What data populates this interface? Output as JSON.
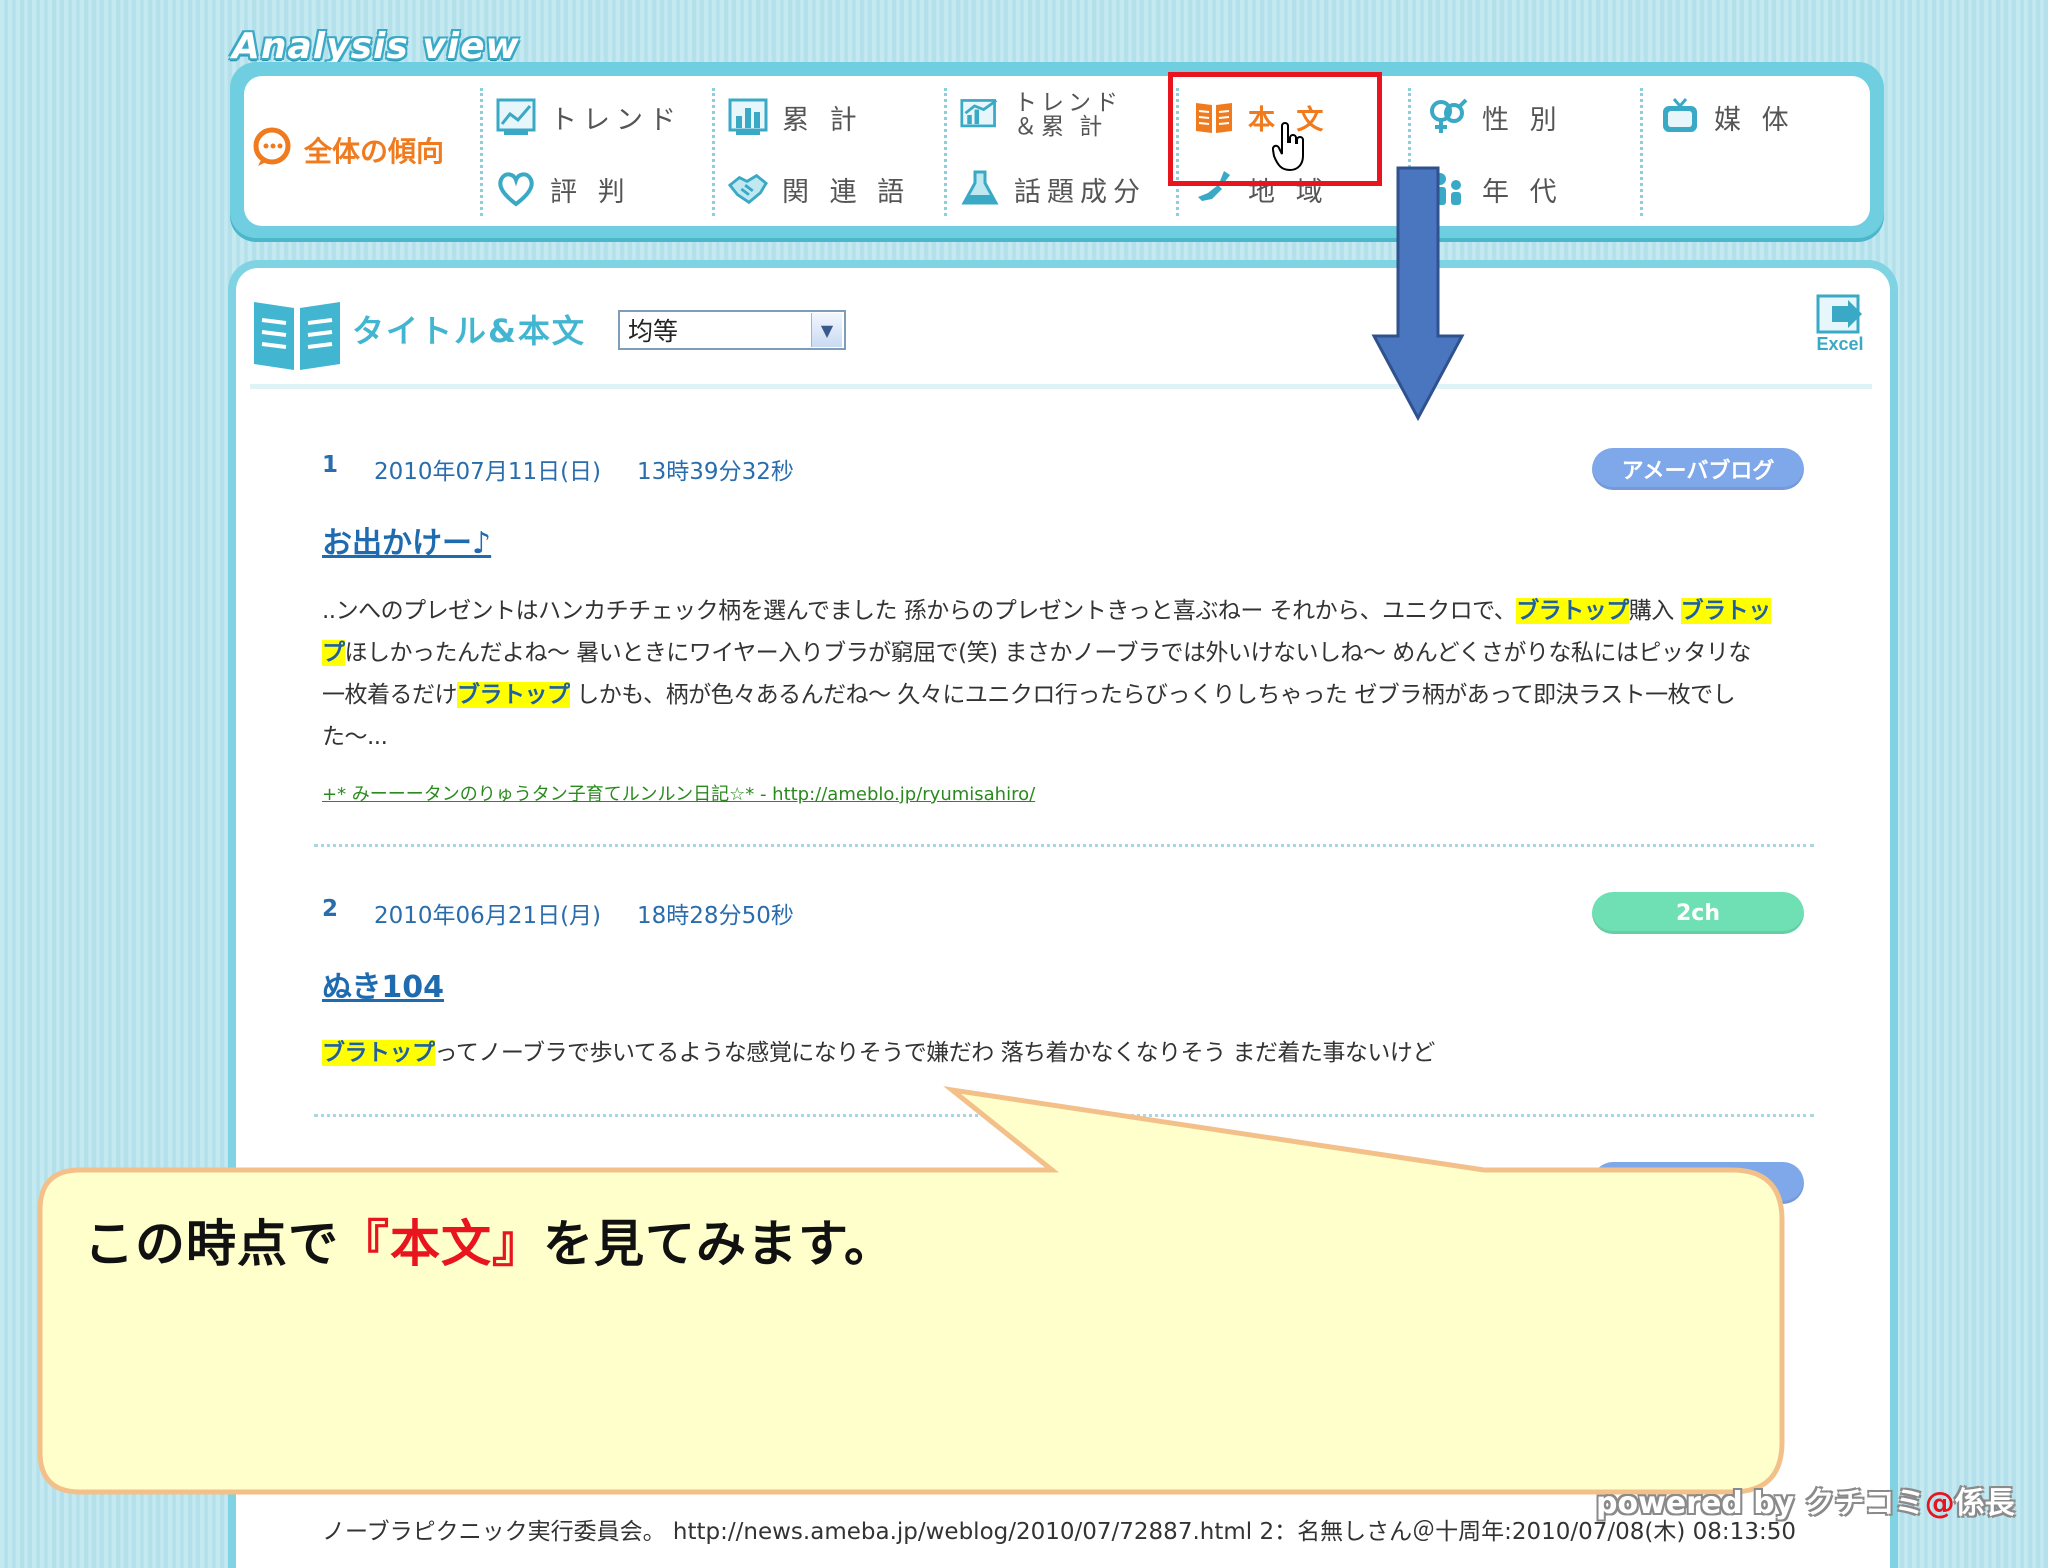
{
  "header": {
    "logo": "Analysis view",
    "overall": "全体の傾向"
  },
  "nav": {
    "trend": "トレンド",
    "cumulative": "累 計",
    "trend_cum_line1": "トレンド",
    "trend_cum_line2": "＆累 計",
    "body_text": "本 文",
    "gender": "性 別",
    "media": "媒 体",
    "reputation": "評 判",
    "related_words": "関 連 語",
    "topic_components": "話題成分",
    "region": "地 域",
    "age": "年 代"
  },
  "panel": {
    "title": "タイトル&本文",
    "sort_value": "均等",
    "excel_label": "Excel"
  },
  "entries": [
    {
      "num": "1",
      "date": "2010年07月11日(日)",
      "time": "13時39分32秒",
      "badge": "アメーバブログ",
      "badge_color": "#7fa8ea",
      "title": "お出かけー♪",
      "body_1": "..ンへのプレゼントはハンカチチェック柄を選んでました 孫からのプレゼントきっと喜ぶねー それから、ユニクロで、",
      "keyword": "ブラトップ",
      "body_2": "購入 ",
      "keyword_2": "ブラトッ",
      "keyword_3": "プ",
      "body_3": "ほしかったんだよね～ 暑いときにワイヤー入りブラが窮屈で(笑) まさかノーブラでは外いけないしね～ めんどくさがりな私にはピッタリな",
      "body_4": "一枚着るだけ",
      "keyword_4": "ブラトップ",
      "body_5": " しかも、柄が色々あるんだね～ 久々にユニクロ行ったらびっくりしちゃった ゼブラ柄があって即決ラスト一枚でし",
      "body_6": "た～...",
      "source": "+* みーーータンのりゅうタン子育てルンルン日記☆* - http://ameblo.jp/ryumisahiro/"
    },
    {
      "num": "2",
      "date": "2010年06月21日(月)",
      "time": "18時28分50秒",
      "badge": "2ch",
      "badge_color": "#6fe0b4",
      "title": "ぬき104",
      "keyword": "ブラトップ",
      "body_1": "ってノーブラで歩いてるような感覚になりそうで嫌だわ 落ち着かなくなりそう まだ着た事ないけど"
    }
  ],
  "callout": {
    "prefix": "この時点で",
    "open_bracket": "『",
    "highlight": "本文",
    "close_bracket": "』",
    "suffix": "を見てみます。"
  },
  "footer": {
    "bottom_line": "ノーブラピクニック実行委員会。 http://news.ameba.jp/weblog/2010/07/72887.html 2：名無しさん＠十周年:2010/07/08(木) 08:13:50",
    "powered_prefix": "powered by クチコミ",
    "powered_at": "@",
    "powered_suffix": "係長"
  }
}
